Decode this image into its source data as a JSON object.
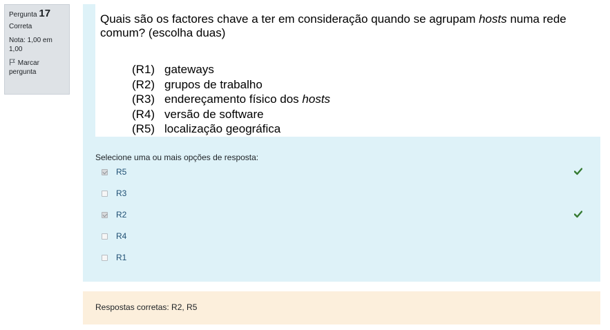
{
  "info": {
    "question_label": "Pergunta",
    "question_number": "17",
    "state": "Correta",
    "grade": "Nota: 1,00 em 1,00",
    "flag_label": "Marcar pergunta"
  },
  "question": {
    "line1_before": "Quais são os factores chave a ter em consideração quando se agrupam ",
    "line1_italic": "hosts",
    "line1_after": " numa rede",
    "line2": "comum? (escolha duas)",
    "options": [
      {
        "code": "(R1)",
        "text": "gateways",
        "italic": ""
      },
      {
        "code": "(R2)",
        "text": "grupos de trabalho",
        "italic": ""
      },
      {
        "code": "(R3)",
        "text": "endereçamento físico dos ",
        "italic": "hosts"
      },
      {
        "code": "(R4)",
        "text": "versão de software",
        "italic": ""
      },
      {
        "code": "(R5)",
        "text": "localização geográfica",
        "italic": ""
      }
    ]
  },
  "prompt": "Selecione uma ou mais opções de resposta:",
  "answers": [
    {
      "label": "R5",
      "checked": true,
      "correct": true
    },
    {
      "label": "R3",
      "checked": false,
      "correct": false
    },
    {
      "label": "R2",
      "checked": true,
      "correct": true
    },
    {
      "label": "R4",
      "checked": false,
      "correct": false
    },
    {
      "label": "R1",
      "checked": false,
      "correct": false
    }
  ],
  "right_answer": "Respostas corretas: R2, R5",
  "colors": {
    "info_bg": "#dee2e6",
    "formulation_bg": "#def2f8",
    "feedback_bg": "#fcefdc",
    "correct_tick": "#357a32"
  }
}
